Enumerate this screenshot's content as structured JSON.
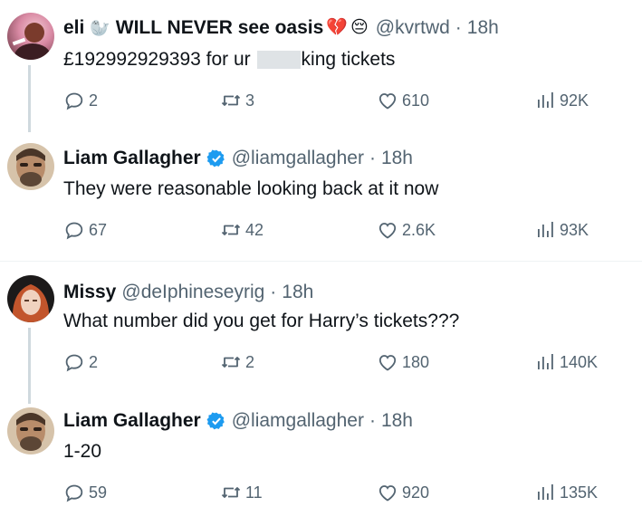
{
  "tweets": [
    {
      "display_name": "eli",
      "name_extra": "WILL NEVER see oasis",
      "handle": "@kvrtwd",
      "time": "18h",
      "text_before": "£192992929393 for ur",
      "text_after": "king tickets",
      "replies": "2",
      "retweets": "3",
      "likes": "610",
      "views": "92K"
    },
    {
      "display_name": "Liam Gallagher",
      "handle": "@liamgallagher",
      "time": "18h",
      "text": "They were reasonable looking back at it now",
      "replies": "67",
      "retweets": "42",
      "likes": "2.6K",
      "views": "93K"
    },
    {
      "display_name": "Missy",
      "handle": "@deIphineseyrig",
      "time": "18h",
      "text": "What number did you get for Harry’s tickets???",
      "replies": "2",
      "retweets": "2",
      "likes": "180",
      "views": "140K"
    },
    {
      "display_name": "Liam Gallagher",
      "handle": "@liamgallagher",
      "time": "18h",
      "text": "1-20",
      "replies": "59",
      "retweets": "11",
      "likes": "920",
      "views": "135K"
    }
  ],
  "separator": "·",
  "colors": {
    "text": "#0f1419",
    "muted": "#536471",
    "verified": "#1d9bf0",
    "thread_line": "#cfd9de"
  },
  "icons": [
    "reply-icon",
    "retweet-icon",
    "like-icon",
    "views-icon",
    "verified-badge-icon"
  ]
}
